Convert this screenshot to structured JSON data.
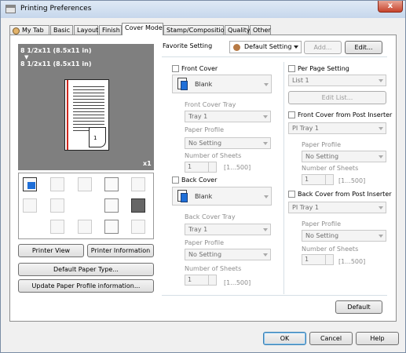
{
  "window": {
    "title": "Printing Preferences",
    "close_label": "x"
  },
  "tabs": [
    {
      "label": "My Tab"
    },
    {
      "label": "Basic"
    },
    {
      "label": "Layout"
    },
    {
      "label": "Finish"
    },
    {
      "label": "Cover Mode"
    },
    {
      "label": "Stamp/Composition"
    },
    {
      "label": "Quality"
    },
    {
      "label": "Other"
    }
  ],
  "active_tab": "Cover Mode",
  "preview": {
    "paper_line1": "8 1/2x11 (8.5x11 in)",
    "arrow": "▼",
    "paper_line2": "8 1/2x11 (8.5x11 in)",
    "page_number": "1",
    "copies": "x1"
  },
  "left_buttons": {
    "printer_view": "Printer View",
    "printer_information": "Printer Information",
    "default_paper_type": "Default Paper Type...",
    "update_paper_profile": "Update Paper Profile information..."
  },
  "favorite": {
    "label": "Favorite Setting",
    "value": "Default Setting",
    "add_label": "Add...",
    "edit_label": "Edit..."
  },
  "front_cover": {
    "label": "Front Cover",
    "cover_value": "Blank",
    "tray_label": "Front Cover Tray",
    "tray_value": "Tray 1",
    "profile_label": "Paper Profile",
    "profile_value": "No Setting",
    "sheets_label": "Number of Sheets",
    "sheets_value": "1",
    "sheets_range": "[1...500]"
  },
  "back_cover": {
    "label": "Back Cover",
    "cover_value": "Blank",
    "tray_label": "Back Cover Tray",
    "tray_value": "Tray 1",
    "profile_label": "Paper Profile",
    "profile_value": "No Setting",
    "sheets_label": "Number of Sheets",
    "sheets_value": "1",
    "sheets_range": "[1...500]"
  },
  "per_page": {
    "label": "Per Page Setting",
    "list_value": "List 1",
    "edit_list_label": "Edit List..."
  },
  "front_post": {
    "label": "Front Cover from Post Inserter",
    "tray_value": "PI Tray 1",
    "profile_label": "Paper Profile",
    "profile_value": "No Setting",
    "sheets_label": "Number of Sheets",
    "sheets_value": "1",
    "sheets_range": "[1...500]"
  },
  "back_post": {
    "label": "Back Cover from Post Inserter",
    "tray_value": "PI Tray 1",
    "profile_label": "Paper Profile",
    "profile_value": "No Setting",
    "sheets_label": "Number of Sheets",
    "sheets_value": "1",
    "sheets_range": "[1...500]"
  },
  "default_label": "Default",
  "dialog_buttons": {
    "ok": "OK",
    "cancel": "Cancel",
    "help": "Help"
  },
  "colors": {
    "title_bg": "#c6d7ec",
    "close_red": "#c7432c",
    "preview_bg": "#7f7f7f",
    "page_line_red": "#d0281e"
  }
}
